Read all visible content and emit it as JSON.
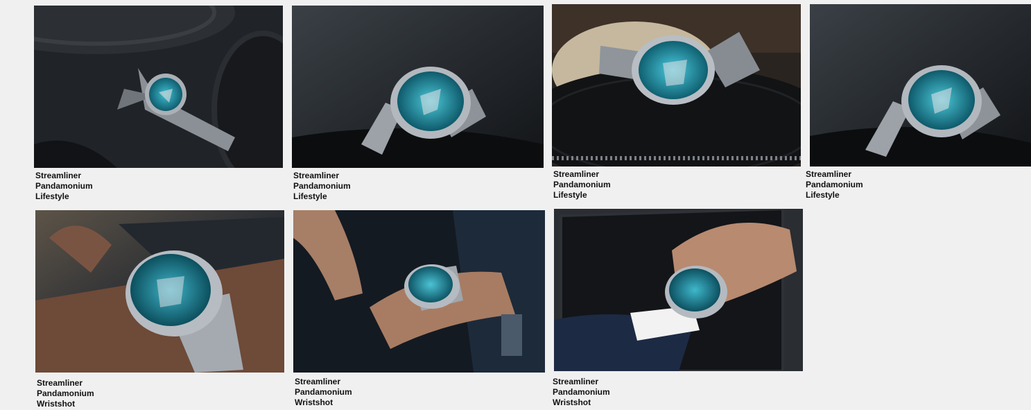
{
  "gallery": {
    "items": [
      {
        "title": "Streamliner",
        "model": "Pandamonium",
        "category": "Lifestyle",
        "icon": "photo-lifestyle-turntable-top"
      },
      {
        "title": "Streamliner",
        "model": "Pandamonium",
        "category": "Lifestyle",
        "icon": "photo-lifestyle-angled"
      },
      {
        "title": "Streamliner",
        "model": "Pandamonium",
        "category": "Lifestyle",
        "icon": "photo-lifestyle-vinyl"
      },
      {
        "title": "Streamliner",
        "model": "Pandamonium",
        "category": "Lifestyle",
        "icon": "photo-lifestyle-angled-crop"
      },
      {
        "title": "Streamliner",
        "model": "Pandamonium",
        "category": "Wristshot",
        "icon": "photo-wristshot-closeup"
      },
      {
        "title": "Streamliner",
        "model": "Pandamonium",
        "category": "Wristshot",
        "icon": "photo-wristshot-dark"
      },
      {
        "title": "Streamliner",
        "model": "Pandamonium",
        "category": "Wristshot",
        "icon": "photo-wristshot-suit"
      }
    ]
  },
  "colors": {
    "background": "#f0f0f0",
    "dial": "#2a9bb0",
    "steel": "#9aa0a6",
    "dark": "#1b1e23"
  }
}
